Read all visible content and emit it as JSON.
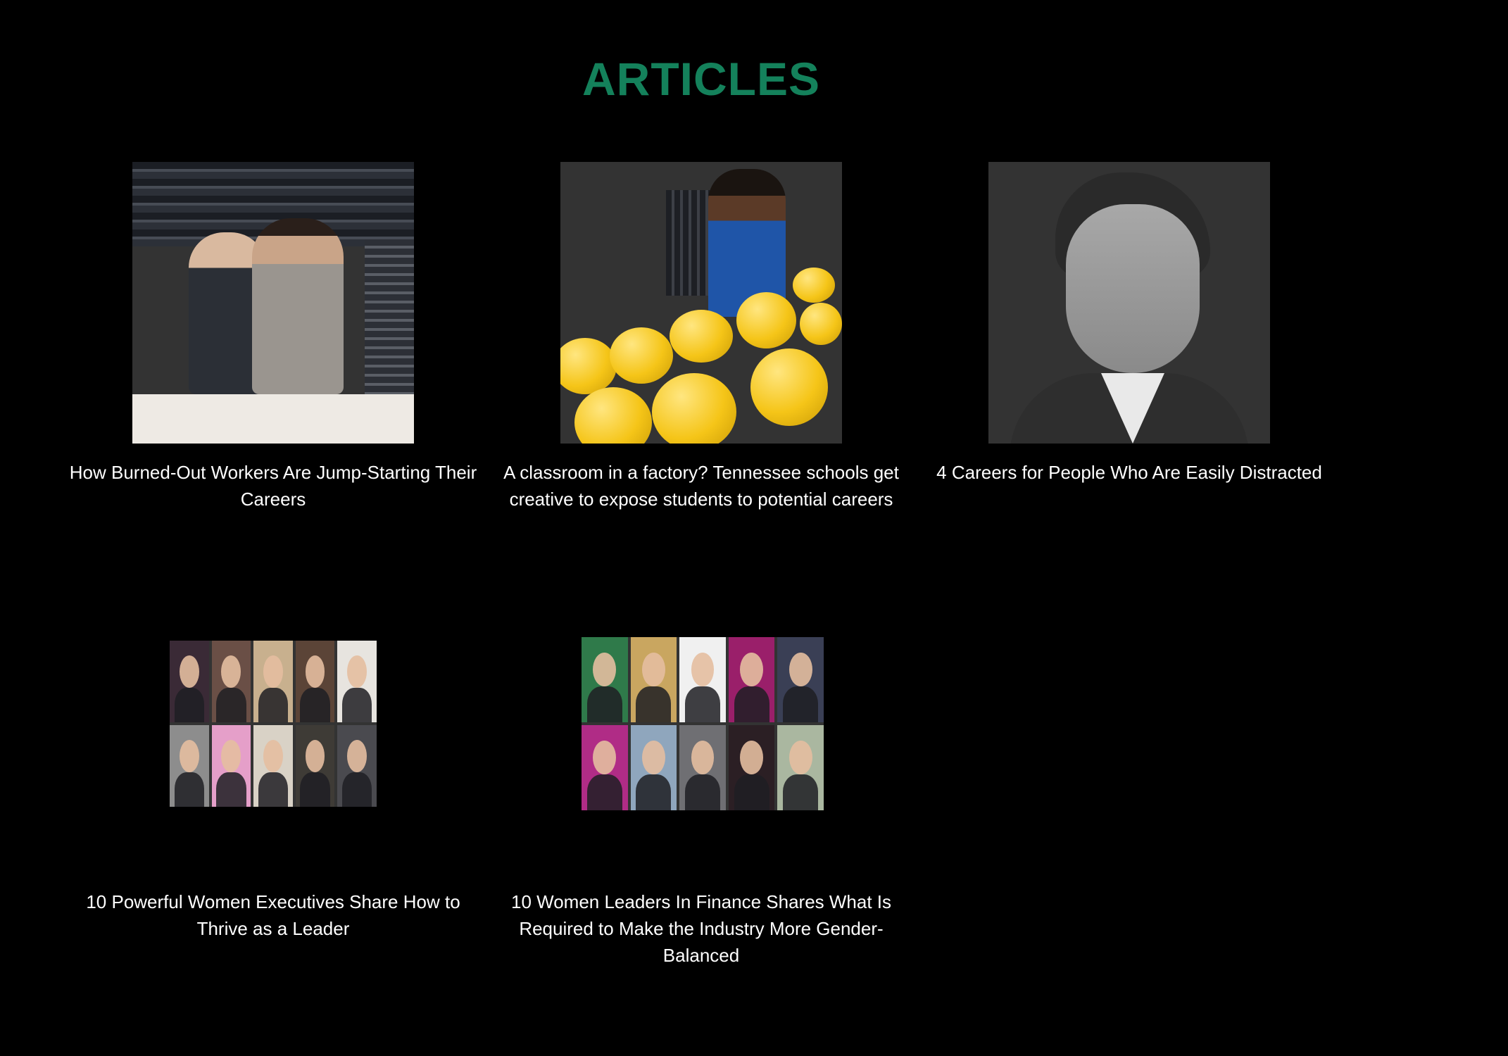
{
  "page": {
    "title": "ARTICLES",
    "title_color": "#14815b",
    "background": "#000000"
  },
  "articles": [
    {
      "title": "How Burned-Out Workers Are Jump-Starting Their Careers",
      "image": "tailors-at-work-photo"
    },
    {
      "title": "A classroom in a factory? Tennessee schools get creative to expose students to potential careers",
      "image": "factory-worker-photo"
    },
    {
      "title": "4 Careers for People Who Are Easily Distracted",
      "image": "man-portrait-photo"
    },
    {
      "title": "10 Powerful Women Executives Share How to Thrive as a Leader",
      "image": "women-executives-collage"
    },
    {
      "title": "10 Women Leaders In Finance Shares What Is Required to Make the Industry More Gender-Balanced",
      "image": "women-finance-leaders-collage"
    }
  ]
}
